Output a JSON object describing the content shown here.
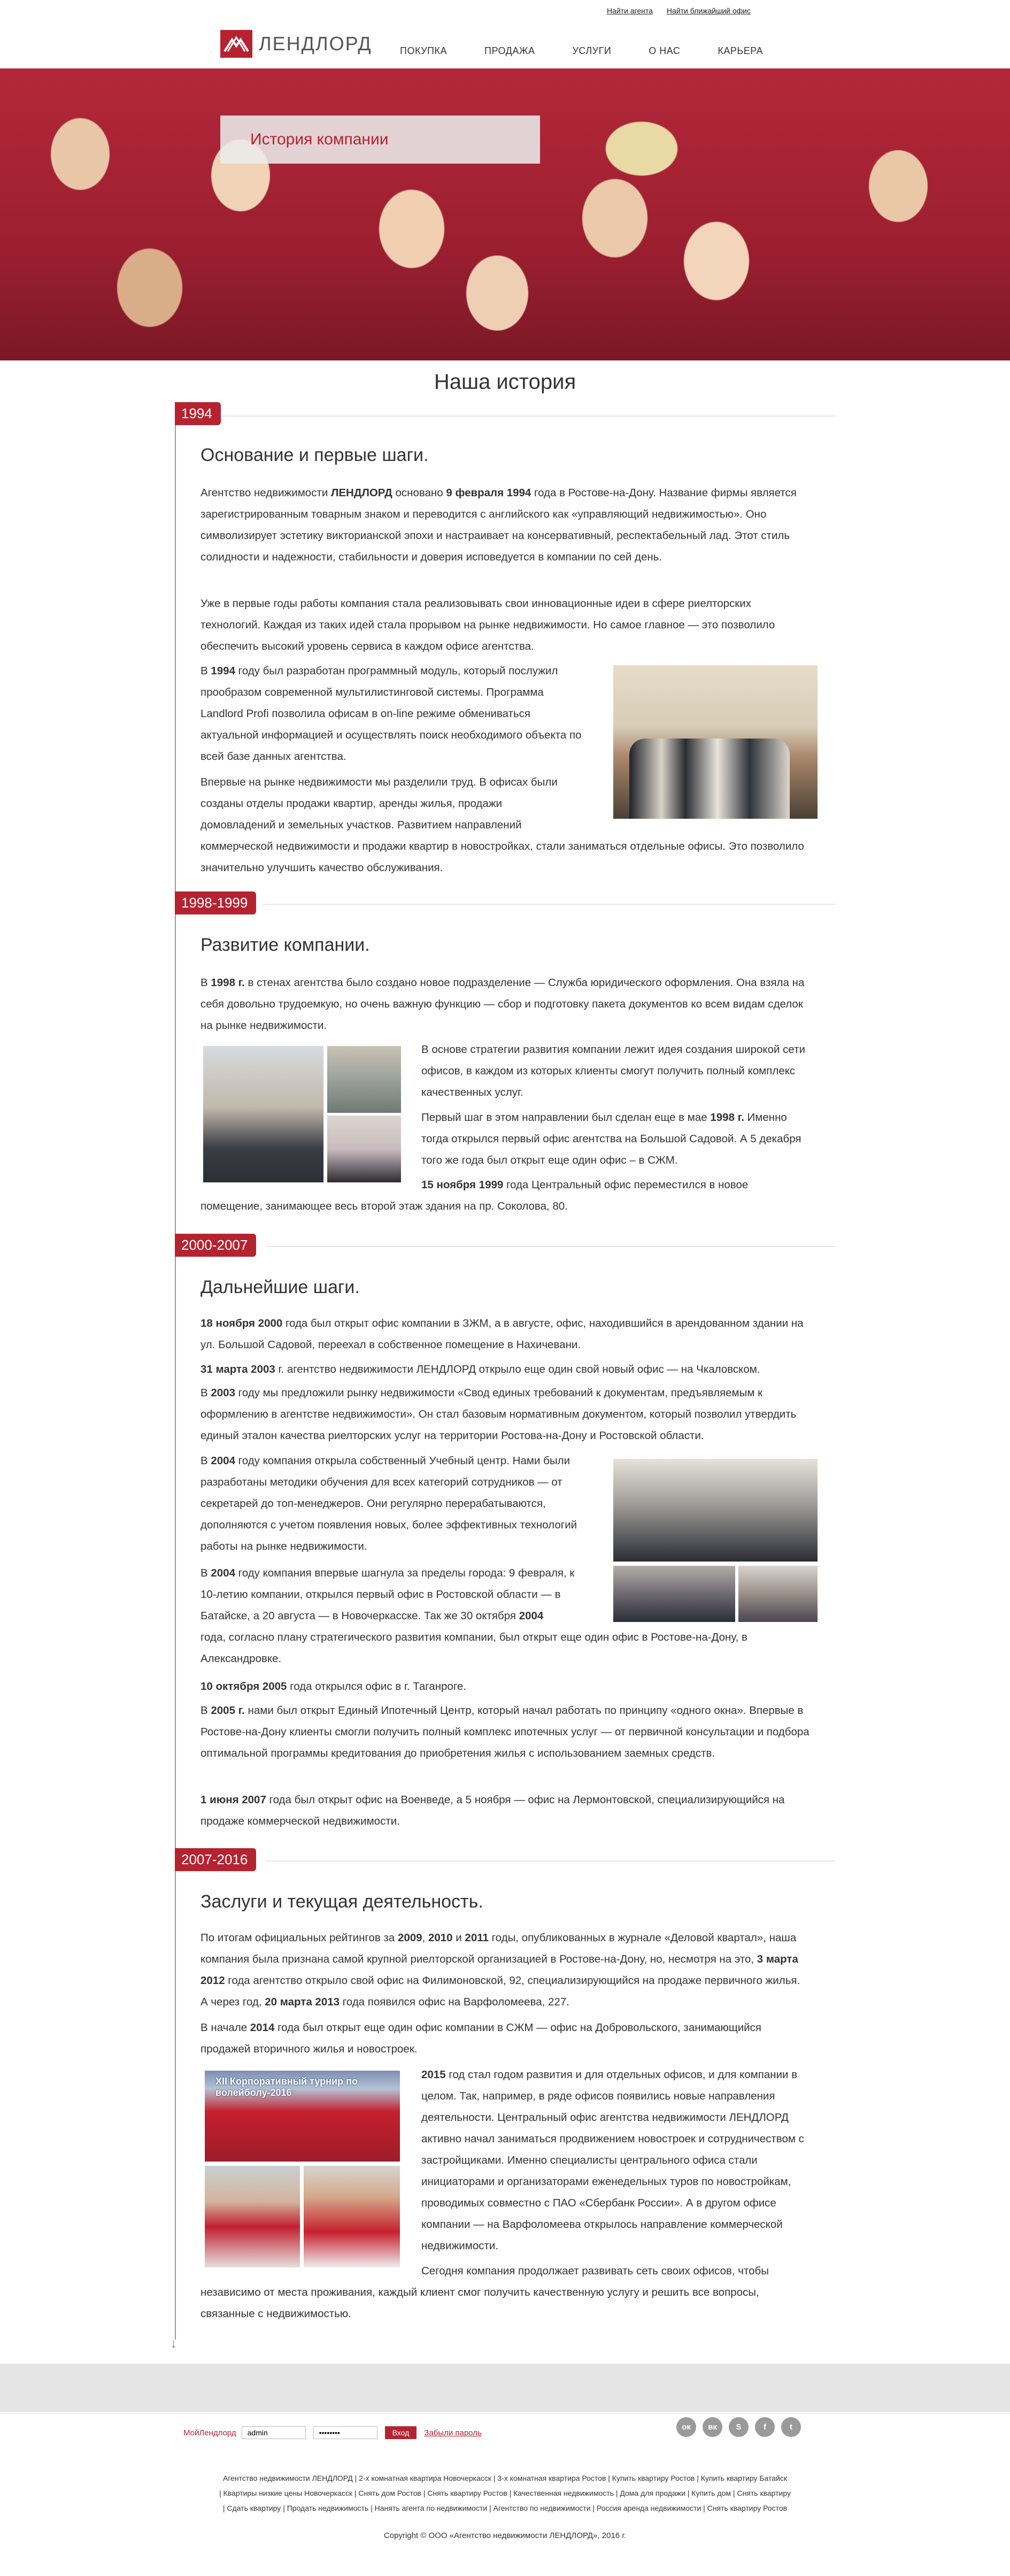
{
  "header": {
    "top_links": [
      "Найти агента",
      "Найти ближайший офис"
    ],
    "logo_text": "ЛЕНДЛОРД",
    "nav": [
      "ПОКУПКА",
      "ПРОДАЖА",
      "УСЛУГИ",
      "О НАС",
      "КАРЬЕРА"
    ]
  },
  "hero": {
    "title": "История компании"
  },
  "page_title": "Наша история",
  "sections": [
    {
      "year": "1994",
      "heading": "Основание и первые шаги.",
      "paragraphs": [
        "Агентство недвижимости ЛЕНДЛОРД основано 9 февраля 1994 года в Ростове-на-Дону. Название фирмы является зарегистрированным товарным знаком и переводится с английского как «управляющий недвижимостью». Оно символизирует эстетику викторианской эпохи и настраивает на консервативный, респектабельный лад. Этот стиль солидности и надежности, стабильности и доверия исповедуется в компании по сей день.",
        "Уже в первые годы работы компания стала реализовывать свои инновационные идеи в сфере риелторских технологий. Каждая из таких идей стала прорывом на рынке недвижимости. Но самое главное — это позволило обеспечить высокий уровень сервиса в каждом офисе агентства.",
        "В 1994 году был разработан программный модуль, который послужил прообразом современной мультилистинговой системы. Программа Landlord Profi позволила офисам в on-line режиме обмениваться актуальной информацией и осуществлять поиск необходимого объекта по всей базе данных агентства.",
        "Впервые на рынке недвижимости мы разделили труд. В офисах были созданы отделы продажи квартир, аренды жилья, продажи домовладений и земельных участков. Развитием направлений коммерческой недвижимости и продажи квартир в новостройках, стали заниматься отдельные офисы. Это позволило значительно улучшить качество обслуживания."
      ]
    },
    {
      "year": "1998-1999",
      "heading": "Развитие компании.",
      "paragraphs": [
        "В 1998 г. в стенах агентства было создано новое подразделение — Служба юридического оформления. Она взяла на себя довольно трудоемкую, но очень важную функцию — сбор и подготовку пакета документов ко всем видам сделок на рынке недвижимости.",
        "В основе стратегии развития компании лежит идея создания широкой сети офисов, в каждом из которых клиенты смогут получить полный комплекс качественных услуг.",
        "Первый шаг в этом направлении был сделан еще в мае 1998 г. Именно тогда открылся первый офис агентства на Большой Садовой. А 5 декабря того же года был открыт еще один офис – в СЖМ.",
        "15 ноября 1999 года Центральный офис переместился в новое помещение, занимающее весь второй этаж здания на пр. Соколова, 80."
      ]
    },
    {
      "year": "2000-2007",
      "heading": "Дальнейшие шаги.",
      "paragraphs": [
        "18 ноября 2000 года был открыт офис компании в ЗЖМ, а в августе, офис, находившийся в арендованном здании на ул. Большой Садовой, переехал в собственное помещение в Нахичевани.",
        "31 марта 2003 г. агентство недвижимости ЛЕНДЛОРД открыло еще один свой новый офис — на Чкаловском.",
        "В 2003 году мы предложили рынку недвижимости «Свод единых требований к документам, предъявляемым к оформлению в агентстве недвижимости». Он стал базовым нормативным документом, который позволил утвердить единый эталон качества риелторских услуг на территории Ростова-на-Дону и Ростовской области.",
        "В 2004 году компания открыла собственный Учебный центр. Нами были разработаны методики обучения для всех категорий сотрудников — от секретарей до топ-менеджеров. Они регулярно перерабатываются, дополняются с учетом появления новых, более эффективных технологий работы на рынке недвижимости.",
        "В 2004 году компания впервые шагнула за пределы города: 9 февраля, к 10-летию компании, открылся первый офис в Ростовской области — в Батайске, а 20 августа — в Новочеркасске. Так же 30 октября 2004 года, согласно плану стратегического развития компании, был открыт еще один офис в Ростове-на-Дону, в Александровке.",
        "10 октября 2005 года открылся офис в г. Таганроге.",
        "В 2005 г. нами был открыт Единый Ипотечный Центр, который начал работать по принципу «одного окна». Впервые в Ростове-на-Дону клиенты смогли получить полный комплекс ипотечных услуг — от первичной консультации и подбора оптимальной программы кредитования до приобретения жилья с использованием заемных средств.",
        "1 июня 2007 года был открыт офис на Военведе, а 5 ноября — офис на Лермонтовской, специализирующийся на продаже коммерческой недвижимости."
      ]
    },
    {
      "year": "2007-2016",
      "heading": "Заслуги и текущая деятельность.",
      "paragraphs": [
        "По итогам официальных рейтингов за 2009, 2010 и 2011 годы, опубликованных в журнале «Деловой квартал», наша компания была признана самой крупной риелторской организацией в Ростове-на-Дону, но, несмотря на это, 3 марта 2012 года агентство открыло свой офис на Филимоновской, 92, специализирующийся на продаже первичного жилья. А через год, 20 марта 2013 года появился офис на Варфоломеева, 227.",
        "В начале 2014 года был открыт еще один офис компании в СЖМ — офис на Добровольского, занимающийся продажей вторичного жилья и новостроек.",
        "2015 год стал годом развития и для отдельных офисов, и для компании в целом. Так, например, в ряде офисов появились новые направления деятельности. Центральный офис агентства недвижимости ЛЕНДЛОРД активно начал заниматься продвижением новостроек и сотрудничеством с застройщиками. Именно специалисты центрального офиса стали инициаторами и организаторами еженедельных туров по новостройкам, проводимых совместно с ПАО «Сбербанк России». А в другом офисе компании — на Варфоломеева открылось направление коммерческой недвижимости.",
        "Сегодня компания продолжает развивать сеть своих офисов, чтобы независимо от места проживания, каждый клиент смог получить качественную услугу и решить все вопросы, связанные с недвижимостью."
      ],
      "photo_caption": "XII Корпоративный турнир по волейболу-2016"
    }
  ],
  "footer": {
    "login_label": "МойЛендлорд",
    "login_value": "admin",
    "password_value": "••••••••",
    "login_button": "Вход",
    "forgot_link": "Забыли пароль",
    "socials": [
      "ok-icon",
      "vk-icon",
      "skype-icon",
      "facebook-icon",
      "twitter-icon"
    ],
    "social_glyphs": [
      "ок",
      "вк",
      "S",
      "f",
      "t"
    ],
    "links_line1": "Агентство недвижимости ЛЕНДЛОРД | 2-х комнатная квартира Новочеркасск | 3-х комнатная квартира Ростов | Купить квартиру Ростов | Купить квартиру Батайск",
    "links_line2": "| Квартиры низкие цены Новочеркасск | Снять дом Ростов | Снять квартиру Ростов | Качественная недвижимость | Дома для продажи | Купить дом | Снять квартиру",
    "links_line3": "| Сдать квартиру | Продать недвижимость | Нанять агента по недвижимости | Агентство по недвижимости | Россия аренда недвижимости | Снять квартиру Ростов",
    "copyright": "Copyright © ООО «Агентство недвижимости ЛЕНДЛОРД», 2016 г."
  },
  "colors": {
    "accent": "#b52330",
    "gray_band": "#e5e5e5",
    "timeline": "#999999"
  }
}
